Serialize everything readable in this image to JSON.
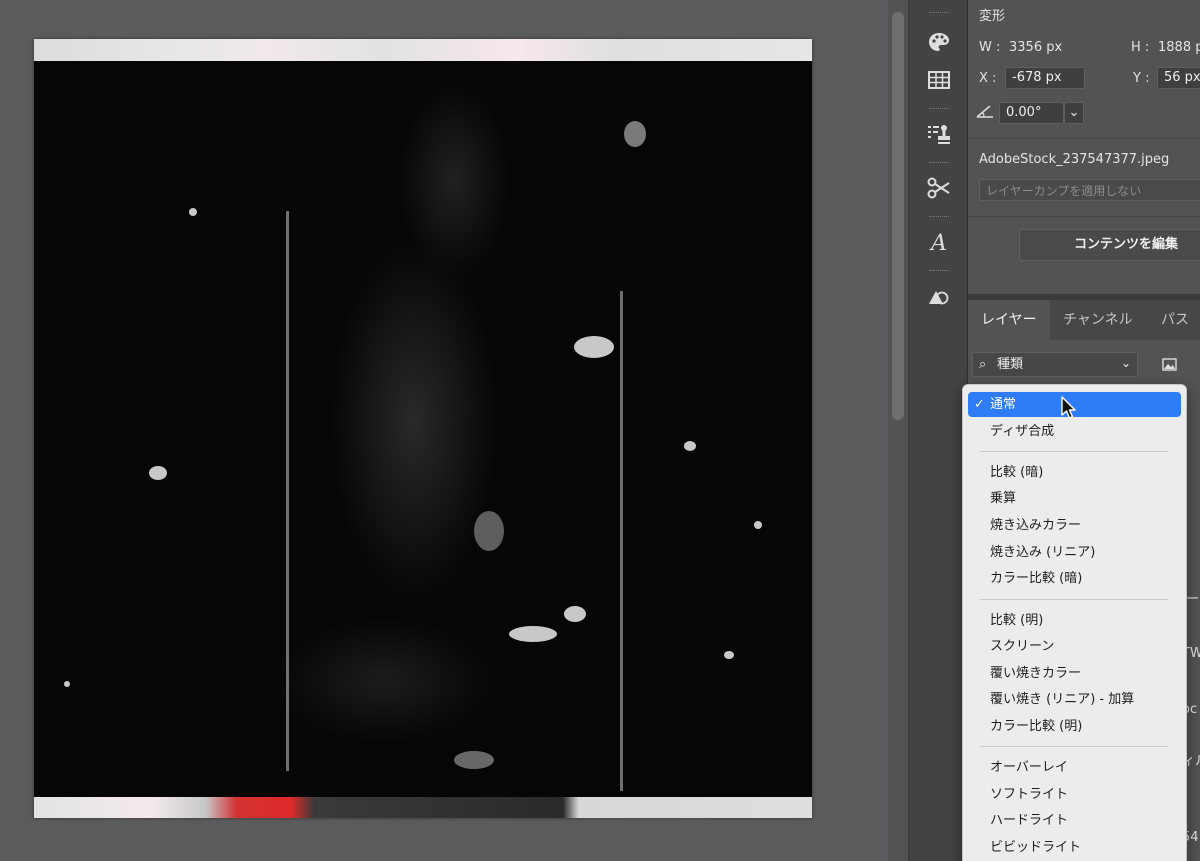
{
  "properties": {
    "section_title": "変形",
    "w_label": "W :",
    "w_value": "3356 px",
    "h_label": "H :",
    "h_value": "1888 px",
    "x_label": "X :",
    "x_value": "-678 px",
    "y_label": "Y :",
    "y_value": "56 px",
    "angle_value": "0.00°",
    "filename": "AdobeStock_237547377.jpeg",
    "layer_comp_placeholder": "レイヤーカンプを適用しない",
    "edit_contents_button": "コンテンツを編集"
  },
  "layers_panel": {
    "tabs": [
      "レイヤー",
      "チャンネル",
      "パス"
    ],
    "filter_label": "種類"
  },
  "blend_menu": {
    "selected": "通常",
    "groups": [
      [
        "通常",
        "ディザ合成"
      ],
      [
        "比較 (暗)",
        "乗算",
        "焼き込みカラー",
        "焼き込み (リニア)",
        "カラー比較 (暗)"
      ],
      [
        "比較 (明)",
        "スクリーン",
        "覆い焼きカラー",
        "覆い焼き (リニア) - 加算",
        "カラー比較 (明)"
      ],
      [
        "オーバーレイ",
        "ソフトライト",
        "ハードライト",
        "ビビッドライト"
      ]
    ]
  },
  "partial_edge_text": [
    "ー",
    "TW",
    "oc",
    "ィル",
    "54"
  ],
  "tool_icons": [
    "palette-icon",
    "grid-table-icon",
    "stamp-list-icon",
    "scissors-icon",
    "glyph-a-icon",
    "shape-rotate-icon"
  ],
  "colors": {
    "menu_highlight": "#2e7cf6",
    "panel_bg": "#535353",
    "accent_red": "#e02a2a"
  }
}
